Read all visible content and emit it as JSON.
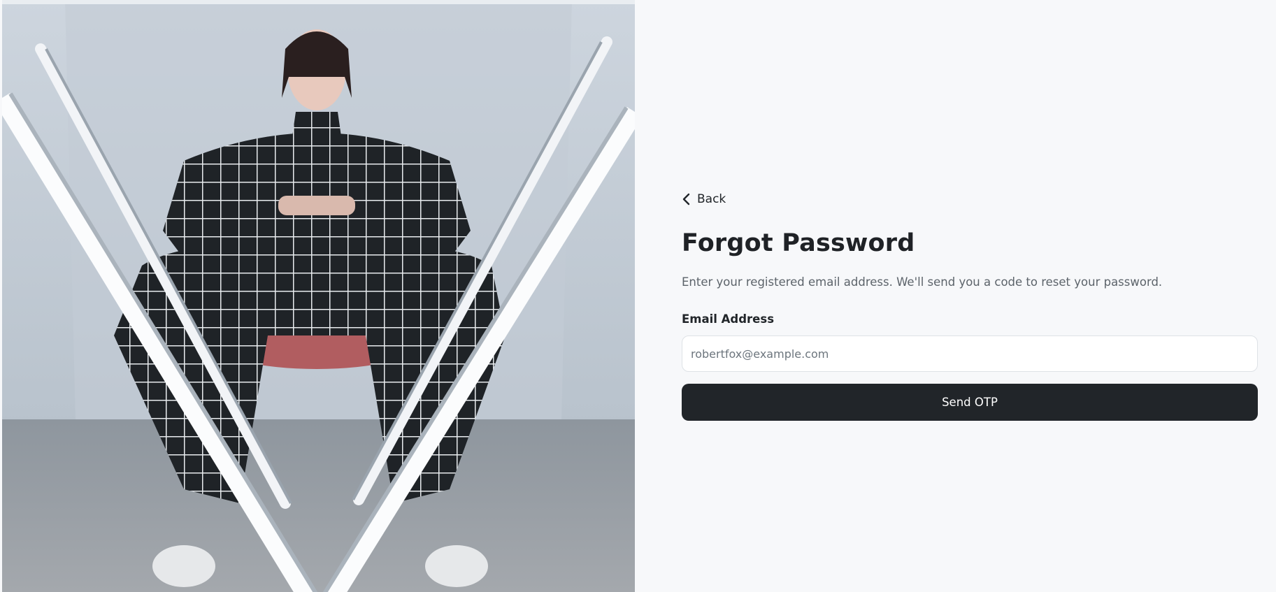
{
  "hero": {
    "alt": "Person in black and white grid outfit seated on a chair framed by neon light tubes"
  },
  "back": {
    "label": "Back",
    "icon": "chevron-left-icon"
  },
  "form": {
    "title": "Forgot Password",
    "subtitle": "Enter your registered email address. We'll send you a code to reset your password.",
    "email_label": "Email Address",
    "email_placeholder": "robertfox@example.com",
    "email_value": "",
    "submit_label": "Send OTP"
  },
  "colors": {
    "background": "#f7f8fa",
    "button": "#212529",
    "button_text": "#ffffff",
    "title": "#1f2226",
    "subtitle": "#5c636a"
  }
}
